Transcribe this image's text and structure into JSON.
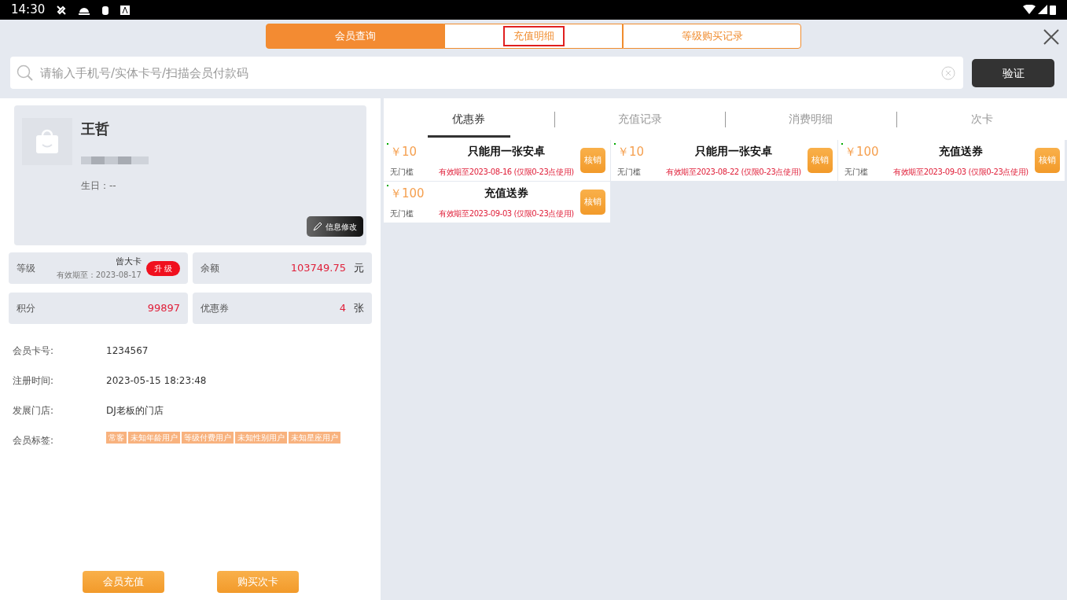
{
  "status_bar": {
    "time": "14:30"
  },
  "top_tabs": [
    {
      "label": "会员查询",
      "selected": true,
      "highlighted": false
    },
    {
      "label": "充值明细",
      "selected": false,
      "highlighted": true
    },
    {
      "label": "等级购买记录",
      "selected": false,
      "highlighted": false
    }
  ],
  "search": {
    "placeholder": "请输入手机号/实体卡号/扫描会员付款码",
    "button": "验证"
  },
  "member": {
    "name": "王哲",
    "birthday": "生日：--",
    "edit_button": "信息修改"
  },
  "stats": [
    {
      "label": "等级",
      "value": "曾大卡",
      "sub": "有效期至：2023-08-17",
      "badge": "升 级",
      "kind": "level"
    },
    {
      "label": "余额",
      "value": "103749.75",
      "unit": "元",
      "kind": "amount"
    },
    {
      "label": "积分",
      "value": "99897",
      "kind": "amount"
    },
    {
      "label": "优惠券",
      "value": "4",
      "unit": "张",
      "kind": "amount"
    }
  ],
  "info": [
    {
      "label": "会员卡号:",
      "value": "1234567"
    },
    {
      "label": "注册时间:",
      "value": "2023-05-15 18:23:48"
    },
    {
      "label": "发展门店:",
      "value": "DJ老板的门店"
    }
  ],
  "tags": {
    "label": "会员标签:",
    "items": [
      "常客",
      "未知年龄用户",
      "等级付费用户",
      "未知性别用户",
      "未知星座用户"
    ]
  },
  "bottom_buttons": [
    "会员充值",
    "购买次卡"
  ],
  "tabs": [
    {
      "label": "优惠券",
      "selected": true
    },
    {
      "label": "充值记录",
      "selected": false
    },
    {
      "label": "消费明细",
      "selected": false
    },
    {
      "label": "次卡",
      "selected": false
    }
  ],
  "coupons": [
    {
      "amount": "￥10",
      "title": "只能用一张安卓",
      "condition": "无门槛",
      "validity": "有效期至2023-08-16 (仅限0-23点使用)",
      "button": "核销"
    },
    {
      "amount": "￥10",
      "title": "只能用一张安卓",
      "condition": "无门槛",
      "validity": "有效期至2023-08-22 (仅限0-23点使用)",
      "button": "核销"
    },
    {
      "amount": "￥100",
      "title": "充值送券",
      "condition": "无门槛",
      "validity": "有效期至2023-09-03 (仅限0-23点使用)",
      "button": "核销"
    },
    {
      "amount": "￥100",
      "title": "充值送券",
      "condition": "无门槛",
      "validity": "有效期至2023-09-03 (仅限0-23点使用)",
      "button": "核销"
    }
  ]
}
